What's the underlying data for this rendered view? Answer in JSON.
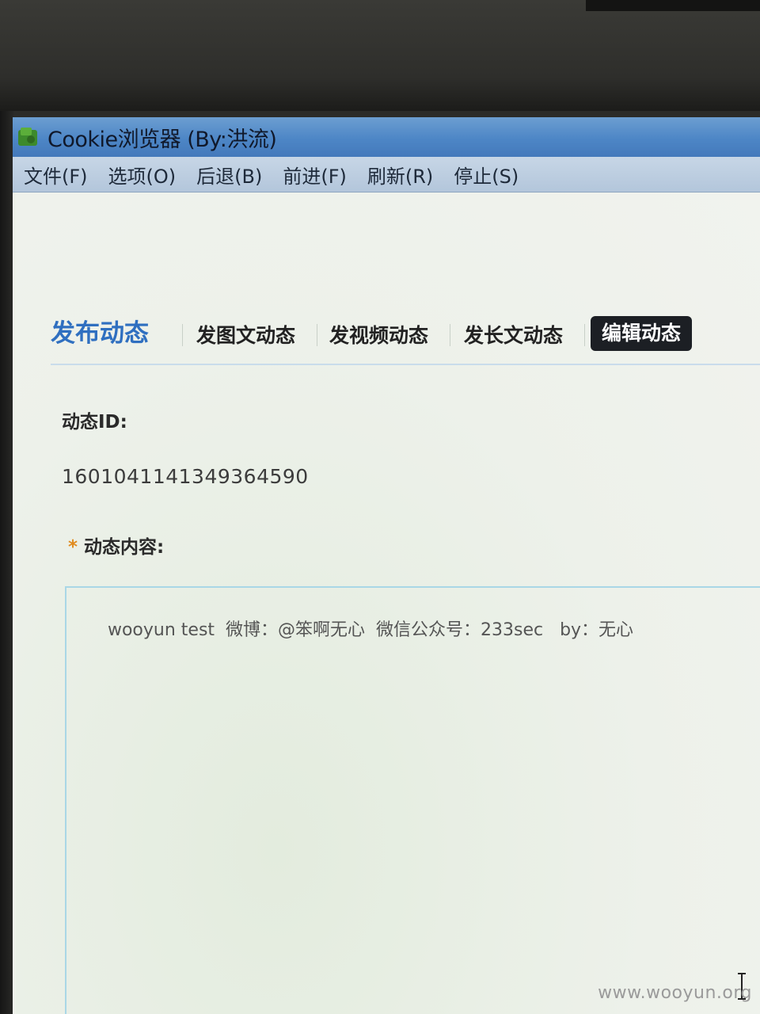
{
  "window": {
    "title": "Cookie浏览器 (By:洪流)"
  },
  "menu": {
    "items": [
      "文件(F)",
      "选项(O)",
      "后退(B)",
      "前进(F)",
      "刷新(R)",
      "停止(S)"
    ]
  },
  "tabs": {
    "main": "发布动态",
    "items": [
      "发图文动态",
      "发视频动态",
      "发长文动态",
      "编辑动态"
    ],
    "active": "编辑动态"
  },
  "form": {
    "id_label": "动态ID:",
    "id_value": "1601041141349364590",
    "required_mark": "*",
    "content_label": "动态内容:",
    "content_value": "wooyun test  微博：@笨啊无心  微信公众号：233sec   by：无心"
  },
  "watermark": "www.wooyun.org",
  "colors": {
    "accent_blue": "#2f6fc0",
    "active_tab_bg": "#1c1f24",
    "required_star": "#e08a1e",
    "titlebar": "#4d86c6"
  }
}
